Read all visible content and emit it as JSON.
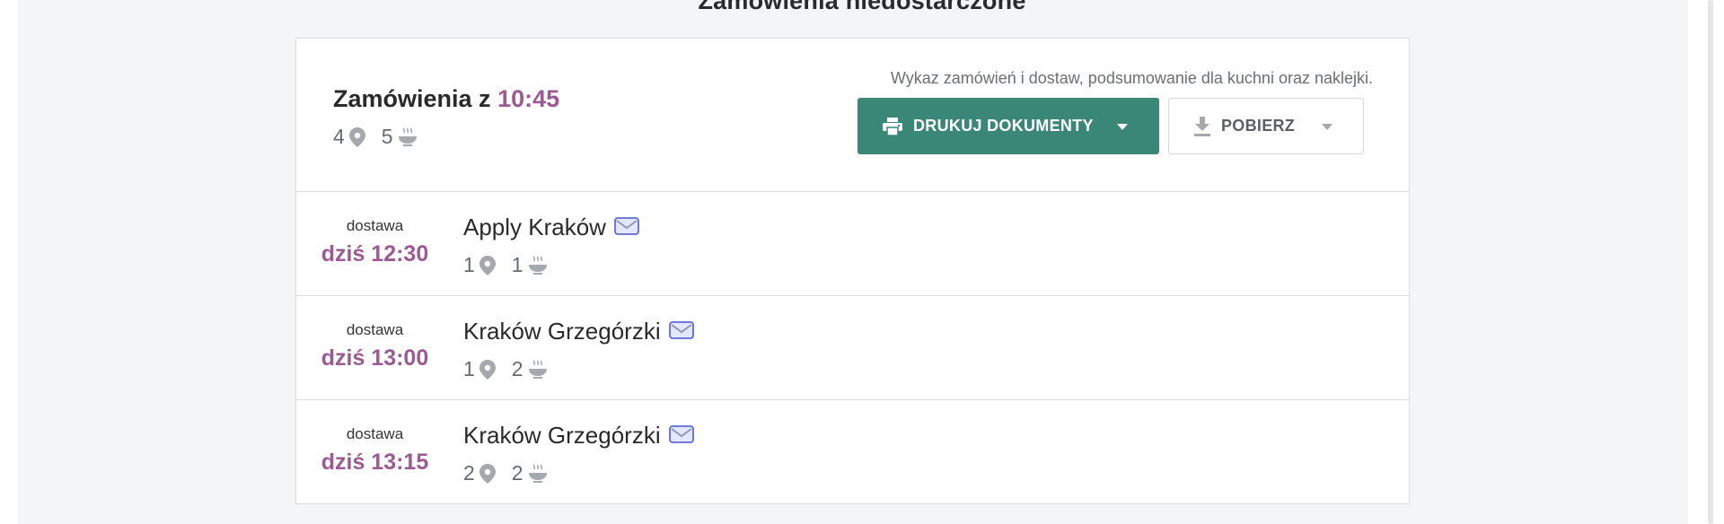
{
  "section": {
    "title": "Zamówienia niedostarczone"
  },
  "header": {
    "title_prefix": "Zamówienia z",
    "title_time": "10:45",
    "locations_count": "4",
    "dishes_count": "5",
    "description": "Wykaz zamówień i dostaw, podsumowanie dla kuchni oraz naklejki."
  },
  "buttons": {
    "print_label": "DRUKUJ DOKUMENTY",
    "download_label": "POBIERZ"
  },
  "orders": [
    {
      "type": "dostawa",
      "time": "dziś 12:30",
      "name": "Apply Kraków",
      "locations": "1",
      "dishes": "1"
    },
    {
      "type": "dostawa",
      "time": "dziś 13:00",
      "name": "Kraków Grzegórzki",
      "locations": "1",
      "dishes": "2"
    },
    {
      "type": "dostawa",
      "time": "dziś 13:15",
      "name": "Kraków Grzegórzki",
      "locations": "2",
      "dishes": "2"
    }
  ],
  "colors": {
    "accent": "#9c5a95",
    "primary_button": "#3a8778",
    "mail_icon": "#5c6bd8"
  },
  "icons": {
    "location": "map-pin-icon",
    "dish": "bowl-icon",
    "mail": "envelope-icon",
    "print": "printer-icon",
    "download": "download-icon",
    "caret": "caret-down-icon"
  }
}
